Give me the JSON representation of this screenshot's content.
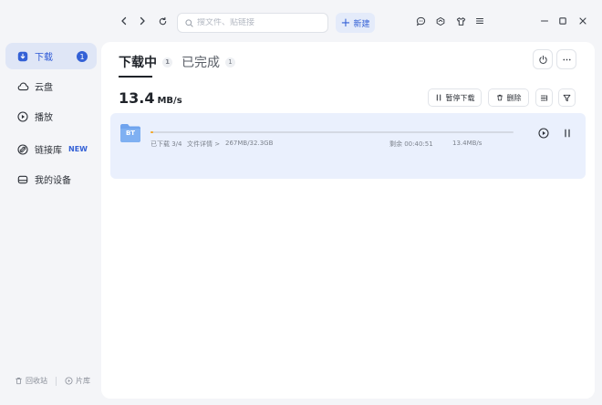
{
  "topbar": {
    "search_placeholder": "搜文件、贴链接",
    "new_label": "新建"
  },
  "sidebar": {
    "items": [
      {
        "label": "下载",
        "badge": "1",
        "icon": "download-icon"
      },
      {
        "label": "云盘",
        "icon": "cloud-icon"
      },
      {
        "label": "播放",
        "icon": "play-circle-icon"
      },
      {
        "label": "链接库",
        "tag": "NEW",
        "icon": "link-icon"
      },
      {
        "label": "我的设备",
        "icon": "device-icon"
      }
    ],
    "bottom": {
      "recycle_label": "回收站",
      "library_label": "片库"
    }
  },
  "main": {
    "tabs": [
      {
        "label": "下载中",
        "count": "1"
      },
      {
        "label": "已完成",
        "count": "1"
      }
    ],
    "speed_value": "13.4",
    "speed_unit": "MB/s",
    "pause_all_label": "暂停下载",
    "delete_label": "删除"
  },
  "task": {
    "file_type": "BT",
    "downloaded": "已下载 3/4",
    "details": "文件详情 >",
    "size": "267MB/32.3GB",
    "remaining": "剩余 00:40:51",
    "speed": "13.4MB/s",
    "progress": 0.008
  },
  "colors": {
    "accent": "#3461d6",
    "active_bg": "#dfe6f6",
    "task_bg": "#eaf0fd",
    "progress": "#f5a623",
    "folder": "#6fa3ee"
  }
}
